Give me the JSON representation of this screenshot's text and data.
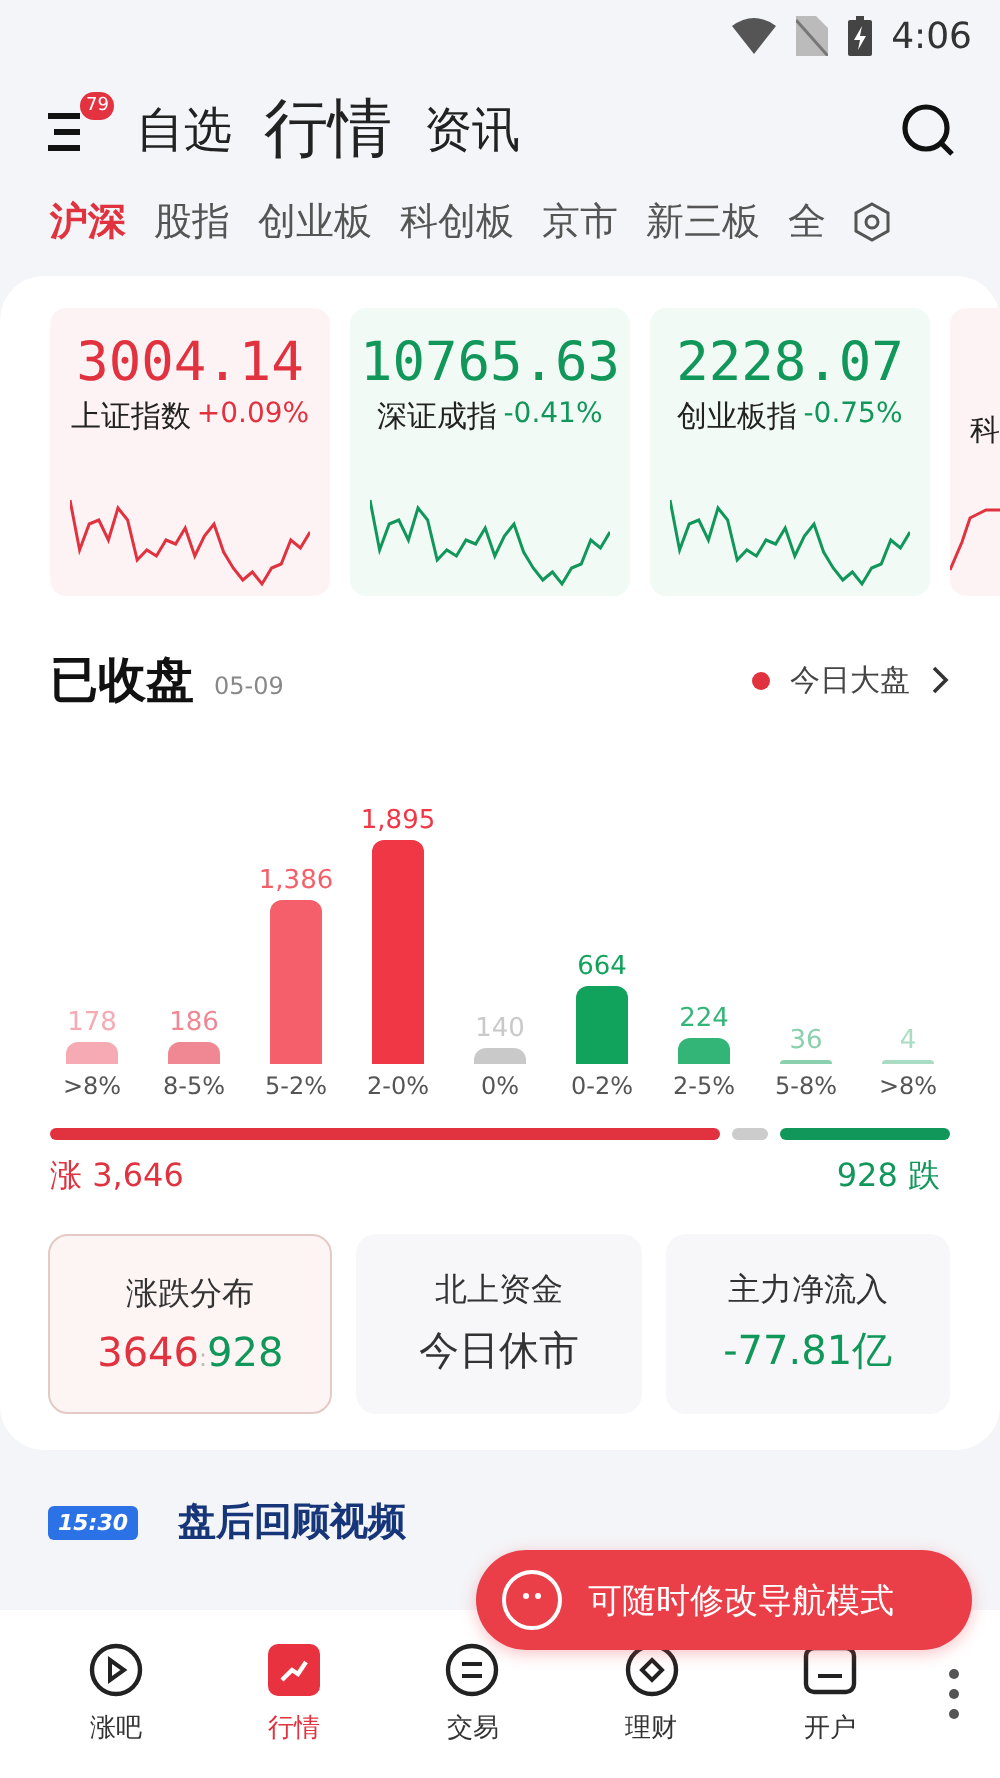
{
  "status_bar": {
    "time": "4:06"
  },
  "header": {
    "badge": "79",
    "tabs": [
      {
        "label": "自选",
        "selected": false
      },
      {
        "label": "行情",
        "selected": true
      },
      {
        "label": "资讯",
        "selected": false
      }
    ]
  },
  "market_tabs": [
    {
      "label": "沪深",
      "selected": true
    },
    {
      "label": "股指",
      "selected": false
    },
    {
      "label": "创业板",
      "selected": false
    },
    {
      "label": "科创板",
      "selected": false
    },
    {
      "label": "京市",
      "selected": false
    },
    {
      "label": "新三板",
      "selected": false
    },
    {
      "label": "全",
      "selected": false
    }
  ],
  "indices": [
    {
      "kind": "full",
      "value": "3004.14",
      "name": "上证指数",
      "change": "+0.09%",
      "color": "#e0323f"
    },
    {
      "kind": "full",
      "value": "10765.63",
      "name": "深证成指",
      "change": "-0.41%",
      "color": "#11975a"
    },
    {
      "kind": "full",
      "value": "2228.07",
      "name": "创业板指",
      "change": "-0.75%",
      "color": "#11975a"
    },
    {
      "kind": "partial",
      "name": "科",
      "color": "#e0323f"
    }
  ],
  "distribution": {
    "title": "已收盘",
    "date": "05-09",
    "link": "今日大盘",
    "chart_data": {
      "type": "bar",
      "categories": [
        ">8%",
        "8-5%",
        "5-2%",
        "2-0%",
        "0%",
        "0-2%",
        "2-5%",
        "5-8%",
        ">8%"
      ],
      "series": [
        {
          "values": [
            178,
            186,
            1386,
            1895,
            140,
            664,
            224,
            36,
            4
          ],
          "value_labels": [
            "178",
            "186",
            "1,386",
            "1,895",
            "140",
            "664",
            "224",
            "36",
            "4"
          ]
        }
      ]
    },
    "bars": [
      {
        "color": "#f5aab4"
      },
      {
        "color": "#f08893"
      },
      {
        "color": "#f45f6b"
      },
      {
        "color": "#f03745"
      },
      {
        "color": "#c9c9c9"
      },
      {
        "color": "#11a35b"
      },
      {
        "color": "#33b578"
      },
      {
        "color": "#8ad0ae"
      },
      {
        "color": "#aadcc4"
      }
    ],
    "segments": [
      {
        "color": "#e0323f"
      },
      {
        "color": "#cccccc"
      },
      {
        "color": "#11975a"
      }
    ],
    "rise": "涨 3,646",
    "fall": "928 跌"
  },
  "stat_cards": [
    {
      "title": "涨跌分布",
      "selected": true,
      "parts": [
        {
          "text": "3646",
          "color": "#e0323f"
        },
        {
          "text": ":",
          "color": "#bbbbbb"
        },
        {
          "text": "928",
          "color": "#11975a"
        }
      ]
    },
    {
      "title": "北上资金",
      "selected": false,
      "parts": [
        {
          "text": "今日休市",
          "color": "#333333"
        }
      ]
    },
    {
      "title": "主力净流入",
      "selected": false,
      "parts": [
        {
          "text": "-77.81亿",
          "color": "#11975a"
        }
      ]
    }
  ],
  "video_banner": {
    "badge": "15:30",
    "title": "盘后回顾视频"
  },
  "tooltip": {
    "text": "可随时修改导航模式"
  },
  "bottom_nav": [
    {
      "label": "涨吧",
      "selected": false
    },
    {
      "label": "行情",
      "selected": true
    },
    {
      "label": "交易",
      "selected": false
    },
    {
      "label": "理财",
      "selected": false
    },
    {
      "label": "开户",
      "selected": false
    }
  ]
}
